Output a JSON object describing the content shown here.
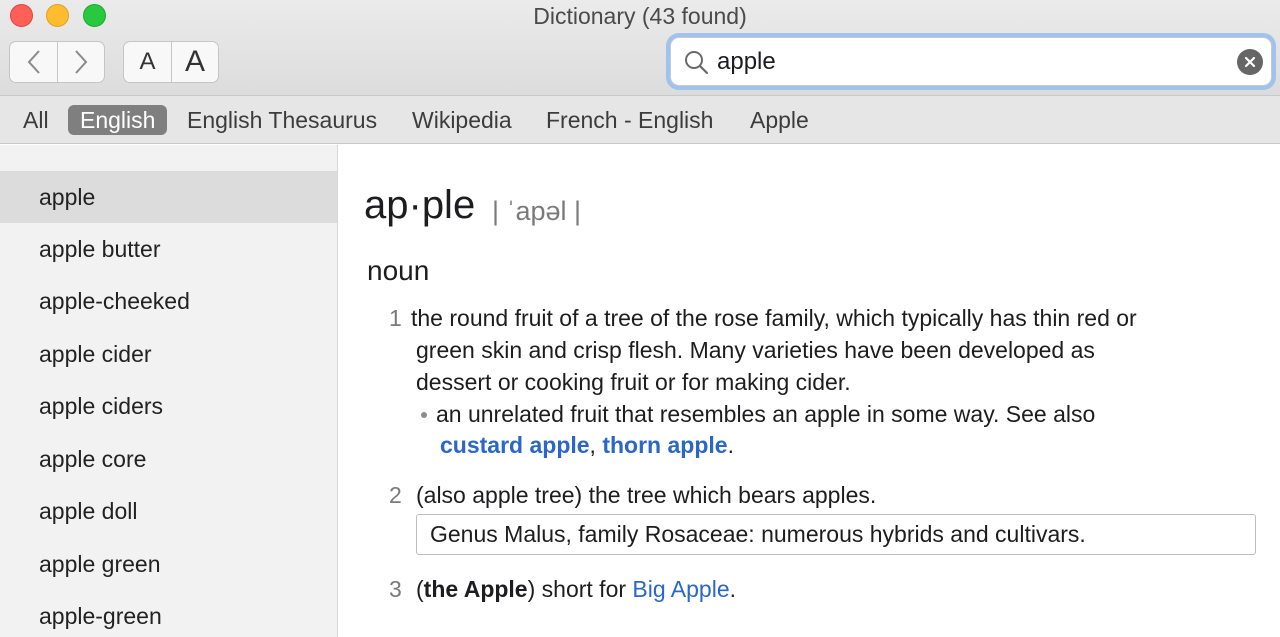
{
  "window": {
    "title": "Dictionary (43 found)"
  },
  "toolbar": {
    "back_icon": "chevron-left-icon",
    "forward_icon": "chevron-right-icon",
    "font_smaller_label": "A",
    "font_larger_label": "A"
  },
  "search": {
    "value": "apple",
    "icon": "magnifier-icon",
    "clear_icon": "clear-icon"
  },
  "scope_tabs": [
    {
      "label": "All",
      "active": false
    },
    {
      "label": "English",
      "active": true
    },
    {
      "label": "English Thesaurus",
      "active": false
    },
    {
      "label": "Wikipedia",
      "active": false
    },
    {
      "label": "French - English",
      "active": false
    },
    {
      "label": "Apple",
      "active": false
    }
  ],
  "results": [
    {
      "label": "apple",
      "selected": true
    },
    {
      "label": "apple butter",
      "selected": false
    },
    {
      "label": "apple-cheeked",
      "selected": false
    },
    {
      "label": "apple cider",
      "selected": false
    },
    {
      "label": "apple ciders",
      "selected": false
    },
    {
      "label": "apple core",
      "selected": false
    },
    {
      "label": "apple doll",
      "selected": false
    },
    {
      "label": "apple green",
      "selected": false
    },
    {
      "label": "apple-green",
      "selected": false
    }
  ],
  "entry": {
    "headword": "ap·ple",
    "pronunciation": "| ˈapəl |",
    "part_of_speech": "noun",
    "sense1": {
      "number": "1",
      "line1": "the round fruit of a tree of the rose family, which typically has thin red or",
      "line2": "green skin and crisp flesh. Many varieties have been developed as",
      "line3": "dessert or cooking fruit or for making cider.",
      "sub_line1": "an unrelated fruit that resembles an apple in some way. See also",
      "link1": "custard apple",
      "separator": ",",
      "link2": "thorn apple",
      "end": "."
    },
    "sense2": {
      "number": "2",
      "text": "(also apple tree) the tree which bears apples.",
      "note": "Genus Malus, family Rosaceae: numerous hybrids and cultivars."
    },
    "sense3": {
      "number": "3",
      "open_paren": "(",
      "bold": "the Apple",
      "close_text": ") short for ",
      "link": "Big Apple",
      "end": "."
    }
  },
  "colors": {
    "link": "#2a67c6",
    "selected_tab": "#7f7f7f",
    "search_focus_ring": "#9fc2ee",
    "close_button": "#fe5f57",
    "minimize_button": "#febc2e",
    "zoom_button": "#28c840"
  }
}
